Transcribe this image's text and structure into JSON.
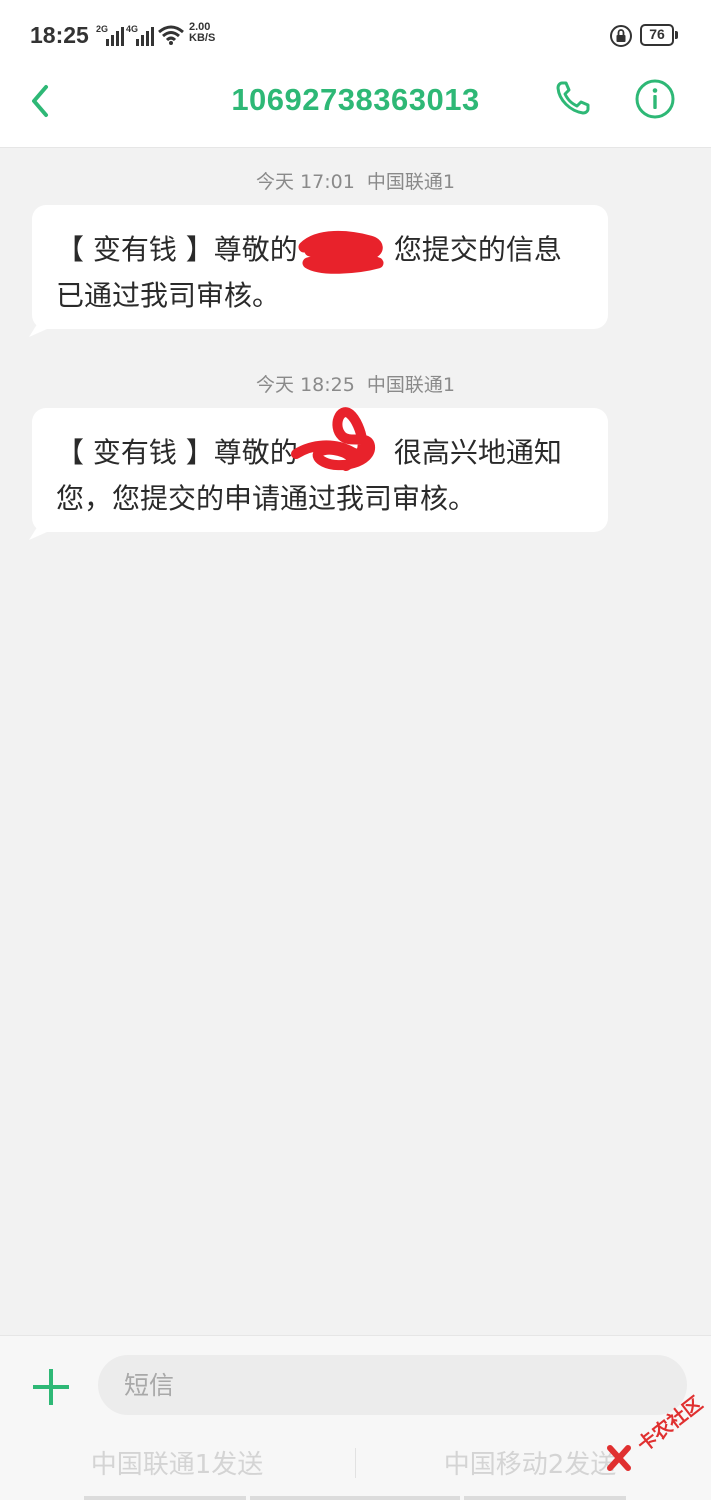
{
  "status_bar": {
    "time": "18:25",
    "sim1_gen": "2G",
    "sim2_gen": "4G",
    "net_speed_value": "2.00",
    "net_speed_unit": "KB/S",
    "battery_level": "76"
  },
  "header": {
    "title": "10692738363013",
    "icons": {
      "back": "back-chevron-icon",
      "call": "phone-icon",
      "info": "info-icon"
    },
    "accent_color": "#2eb876"
  },
  "messages": [
    {
      "date": "今天 17:01",
      "carrier": "中国联通1",
      "line1": "【 变有钱 】尊敬的",
      "line1_after": "您提交的信息",
      "line2": "已通过我司审核。"
    },
    {
      "date": "今天 18:25",
      "carrier": "中国联通1",
      "line1": "【 变有钱 】尊敬的",
      "line1_after": "很高兴地通知",
      "line2": "您，您提交的申请通过我司审核。"
    }
  ],
  "composer": {
    "placeholder": "短信",
    "send_sim1": "中国联通1发送",
    "send_sim2": "中国移动2发送"
  },
  "watermark": {
    "text": "卡农社区",
    "color": "#e03030"
  }
}
